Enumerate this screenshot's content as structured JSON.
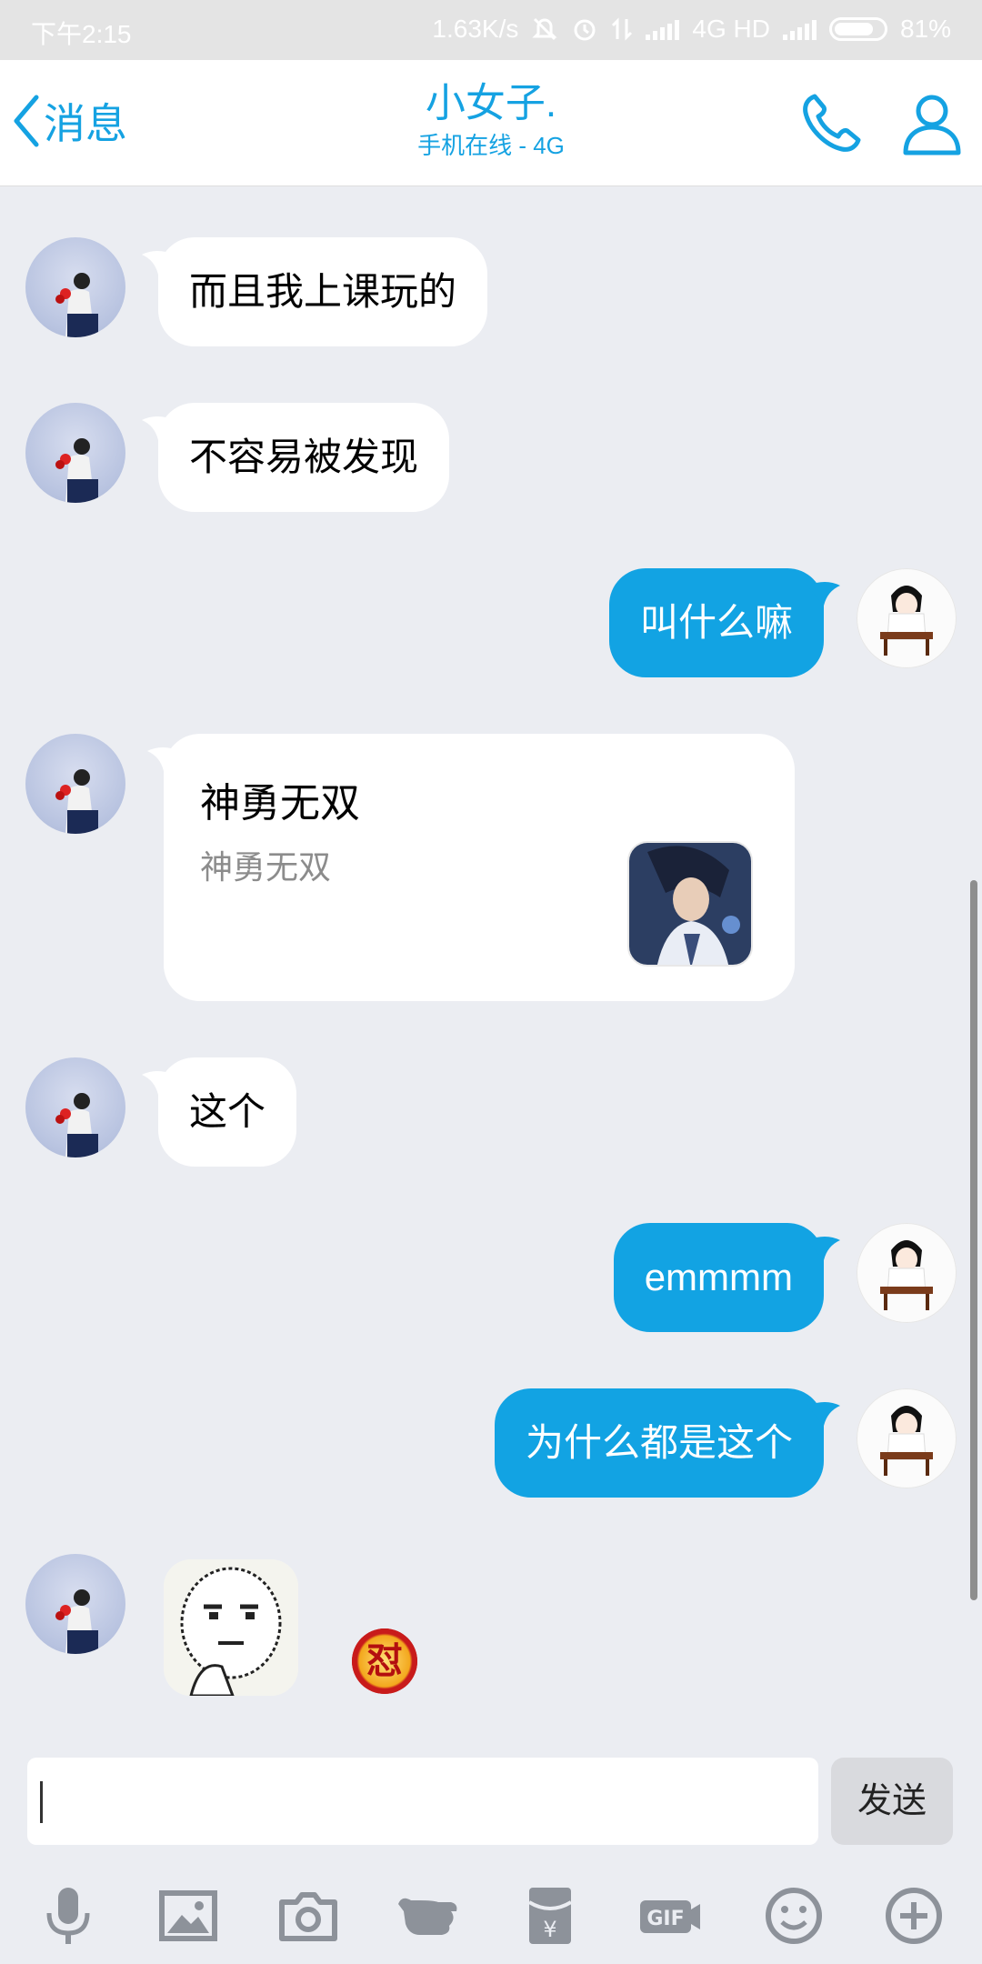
{
  "status_bar": {
    "time": "下午2:15",
    "net_speed": "1.63K/s",
    "network": "4G HD",
    "battery": "81%",
    "battery_level": 0.81
  },
  "header": {
    "back_label": "消息",
    "contact_name": "小女子.",
    "status": "手机在线 - 4G"
  },
  "messages": {
    "m1": "而且我上课玩的",
    "m2": "不容易被发现",
    "m3": "叫什么嘛",
    "m4_card_title": "神勇无双",
    "m4_card_desc": "神勇无双",
    "m5": "这个",
    "m6": "emmmm",
    "m7": "为什么都是这个",
    "m8_badge": "怼"
  },
  "input": {
    "value": "",
    "send_label": "发送"
  },
  "toolbar": [
    "microphone-icon",
    "image-icon",
    "camera-icon",
    "poke-hand-icon",
    "red-packet-icon",
    "gif-icon",
    "emoji-icon",
    "plus-icon"
  ],
  "colors": {
    "accent": "#12a3e3",
    "background": "#ebedf2"
  }
}
